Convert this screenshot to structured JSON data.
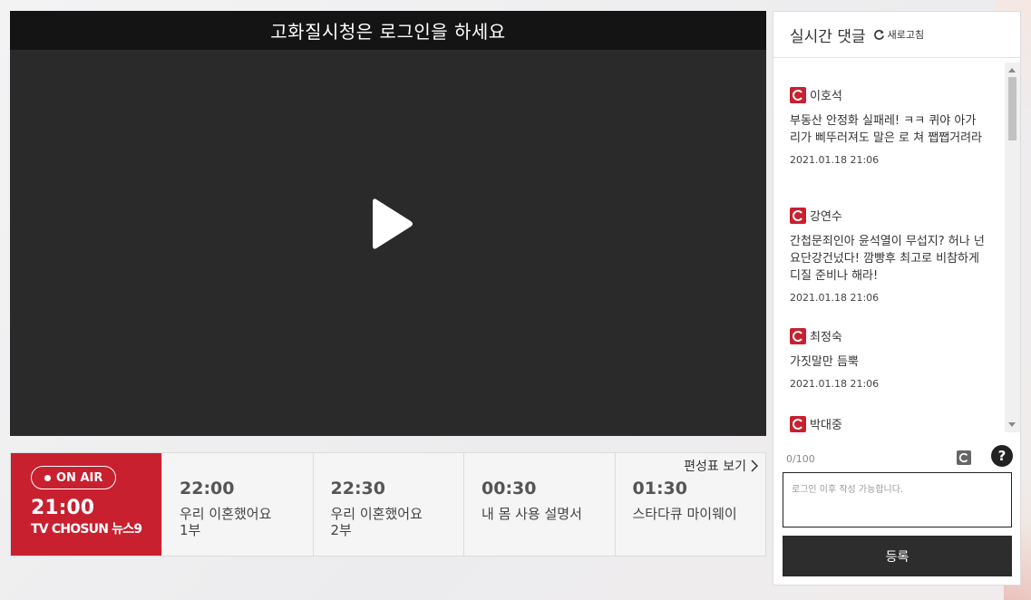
{
  "player": {
    "banner": "고화질시청은 로그인을 하세요",
    "play_icon": "play-icon"
  },
  "schedule": {
    "link_label": "편성표 보기",
    "on_air": {
      "badge": "ON AIR",
      "time": "21:00",
      "show": "TV CHOSUN 뉴스9"
    },
    "slots": [
      {
        "time": "22:00",
        "title": "우리 이혼했어요\n1부"
      },
      {
        "time": "22:30",
        "title": "우리 이혼했어요\n2부"
      },
      {
        "time": "00:30",
        "title": "내 몸 사용 설명서"
      },
      {
        "time": "01:30",
        "title": "스타다큐 마이웨이"
      }
    ]
  },
  "comments_panel": {
    "title": "실시간 댓글",
    "refresh_label": "새로고침",
    "comments": [
      {
        "user": "이호석",
        "text": "부동산 안정화 실패레! ㅋㅋ 퀴야 아가 리가 삐뚜러져도 말은 로 쳐 쨉쨉거려라",
        "date": "2021.01.18 21:06"
      },
      {
        "user": "강연수",
        "text": "간첩문죄인아 윤석열이 무섭지? 허나 넌 요단강건넜다! 깜빵후 최고로 비참하게 디질 준비나 해라!",
        "date": "2021.01.18 21:06"
      },
      {
        "user": "최정숙",
        "text": "가짓말만 듬뿍",
        "date": "2021.01.18 21:06"
      },
      {
        "user": "박대중",
        "text": "",
        "date": ""
      }
    ],
    "counter": "0/100",
    "input_placeholder": "로그인 이후 작성 가능합니다.",
    "submit_label": "등록",
    "help_label": "?"
  },
  "colors": {
    "brand_red": "#c8202f",
    "dark": "#2d2d2d"
  }
}
